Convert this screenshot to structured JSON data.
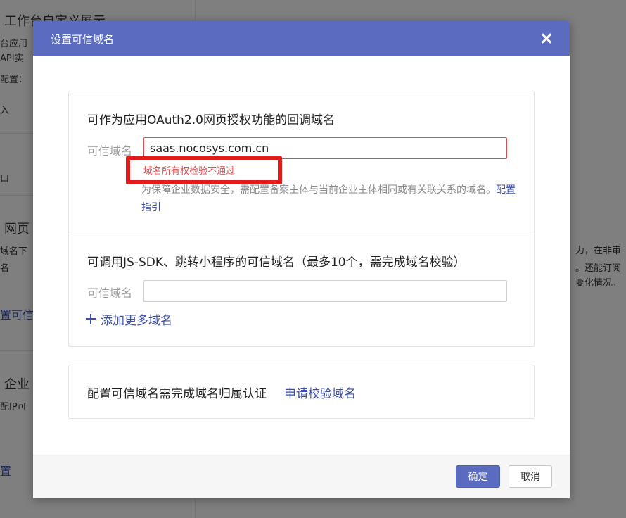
{
  "background": {
    "title": "工作台自定义展示",
    "line1": "台应用",
    "line2": "API实",
    "line3": "配置：",
    "line4": "入",
    "line5": "口",
    "section2_title": "网页",
    "section2_line1": "域名下",
    "section2_line2": "名",
    "section2_link": "置可信域",
    "right_line1": "力，在非审",
    "right_line2": "。还能订阅",
    "right_line3": "变化情况。",
    "section3_title": "企业",
    "section3_line1": "配IP可",
    "section3_link": "置"
  },
  "dialog": {
    "title": "设置可信域名",
    "close_icon": "close-icon",
    "oauth": {
      "title": "可作为应用OAuth2.0网页授权功能的回调域名",
      "label": "可信域名",
      "value": "saas.nocosys.com.cn",
      "error": "域名所有权检验不通过",
      "help": "为保障企业数据安全，需配置备案主体与当前企业主体相同或有关联关系的域名。",
      "help_link": "配置指引"
    },
    "jssdk": {
      "title": "可调用JS-SDK、跳转小程序的可信域名（最多10个，需完成域名校验）",
      "label": "可信域名",
      "value": "",
      "add_label": "添加更多域名"
    },
    "verify": {
      "text": "配置可信域名需完成域名归属认证",
      "link": "申请校验域名"
    },
    "buttons": {
      "confirm": "确定",
      "cancel": "取消"
    },
    "colors": {
      "header": "#5b6bbf",
      "link": "#3d4fa8",
      "error": "#e24a4a",
      "highlight": "#e21b1b"
    }
  }
}
